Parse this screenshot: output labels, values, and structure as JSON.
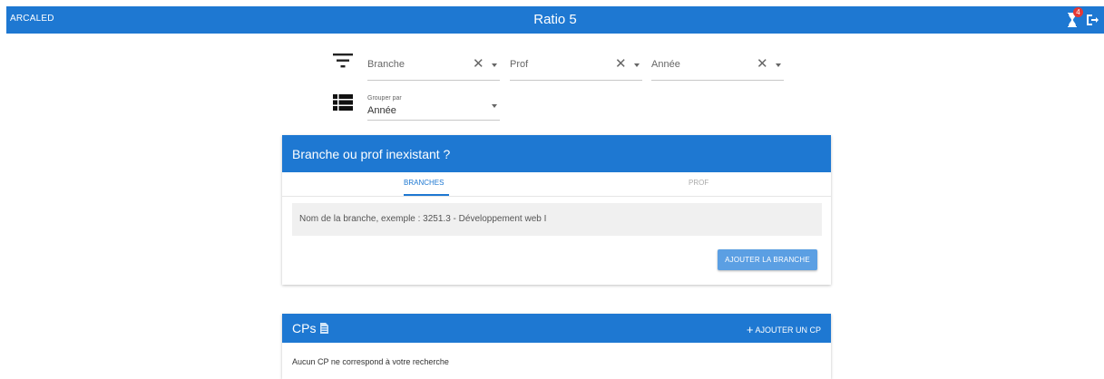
{
  "header": {
    "brand": "ARCALED",
    "title": "Ratio 5",
    "badge_count": "4",
    "color": "#1e78d2"
  },
  "filters": {
    "branche": {
      "placeholder": "Branche"
    },
    "prof": {
      "placeholder": "Prof"
    },
    "annee": {
      "placeholder": "Année"
    },
    "group_by": {
      "label": "Grouper par",
      "value": "Année"
    }
  },
  "branch_card": {
    "title": "Branche ou prof inexistant ?",
    "tabs": [
      "BRANCHES",
      "PROF"
    ],
    "active_tab": "BRANCHES",
    "input_placeholder": "Nom de la branche, exemple : 3251.3 - Développement web I",
    "add_button": "AJOUTER LA BRANCHE"
  },
  "cp_card": {
    "title": "CPs",
    "add_button": "AJOUTER UN CP",
    "empty_message": "Aucun CP ne correspond à votre recherche"
  }
}
